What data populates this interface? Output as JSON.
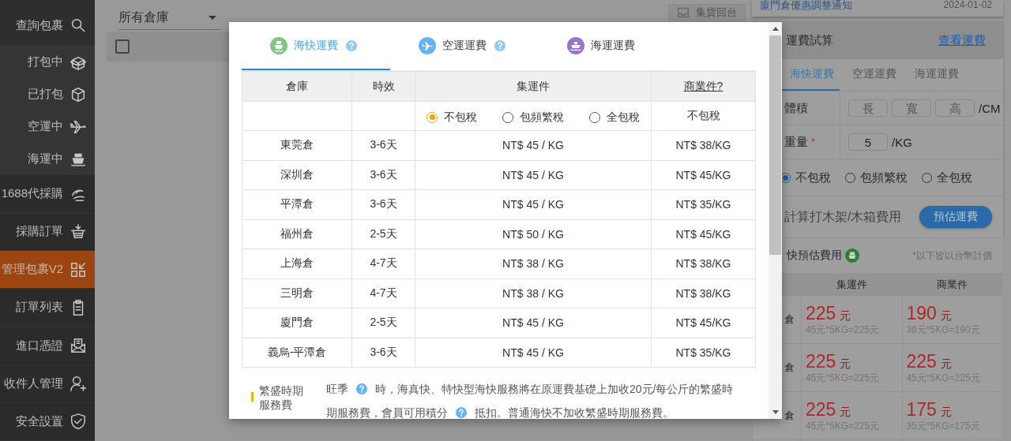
{
  "sidebar": {
    "items": [
      {
        "label": "查詢包裹",
        "selected": false,
        "expanded": true,
        "children": [
          {
            "label": "打包中",
            "selected": false
          },
          {
            "label": "已打包",
            "selected": false
          },
          {
            "label": "空運中",
            "selected": false
          },
          {
            "label": "海運中",
            "selected": false
          }
        ]
      },
      {
        "label": "1688代採購",
        "selected": false
      },
      {
        "label": "採購訂單",
        "selected": false
      },
      {
        "label": "管理包裹V2",
        "selected": true
      },
      {
        "label": "訂單列表",
        "selected": false
      },
      {
        "label": "進口憑證",
        "selected": false
      },
      {
        "label": "收件人管理",
        "selected": false
      },
      {
        "label": "安全設置",
        "selected": false
      }
    ]
  },
  "toolbar": {
    "warehouse_select": {
      "value": "所有倉庫"
    },
    "button": {
      "label": "集貨回台",
      "disabled": true
    }
  },
  "list": {
    "header_checkbox": {
      "checked": false
    }
  },
  "notice": {
    "title": "廈門倉優惠調整通知",
    "date": "2024-01-02"
  },
  "calculator": {
    "title": "運費試算",
    "link": "查看運費",
    "tabs": [
      {
        "label": "海快運費",
        "selected": true
      },
      {
        "label": "空運運費",
        "selected": false
      },
      {
        "label": "海運運費",
        "selected": false
      }
    ],
    "dimensions": {
      "label": "體積",
      "fields": [
        {
          "placeholder": "長"
        },
        {
          "placeholder": "寬"
        },
        {
          "placeholder": "高"
        }
      ],
      "unit": "/CM"
    },
    "weight": {
      "label": "重量",
      "required_mark": "*",
      "value": "5",
      "unit": "/KG"
    },
    "tax_options": [
      {
        "label": "不包稅",
        "selected": true
      },
      {
        "label": "包頻繁稅",
        "selected": false
      },
      {
        "label": "全包稅",
        "selected": false
      }
    ],
    "wood_crate": {
      "label": "計算打木架/木箱費用"
    },
    "submit": "預估運費"
  },
  "estimate": {
    "title": "快預估費用",
    "note": "*以下皆以台幣計價",
    "columns": [
      "集運件",
      "商業件"
    ],
    "rows": [
      {
        "warehouse": "倉",
        "cells": [
          {
            "amount": "225",
            "unit": "元",
            "formula": "45元*5KG=225元"
          },
          {
            "amount": "190",
            "unit": "元",
            "formula": "38元*5KG=190元"
          }
        ]
      },
      {
        "warehouse": "倉",
        "cells": [
          {
            "amount": "225",
            "unit": "元",
            "formula": "45元*5KG=225元"
          },
          {
            "amount": "225",
            "unit": "元",
            "formula": "45元*5KG=225元"
          }
        ]
      },
      {
        "warehouse": "倉",
        "cells": [
          {
            "amount": "225",
            "unit": "元",
            "formula": "45元*5KG=225元"
          },
          {
            "amount": "175",
            "unit": "元",
            "formula": "35元*5KG=175元"
          }
        ]
      }
    ]
  },
  "modal": {
    "tabs": [
      {
        "label": "海快運費",
        "color": "#81c784",
        "help": true,
        "selected": true
      },
      {
        "label": "空運運費",
        "color": "#64b5f6",
        "help": true,
        "selected": false
      },
      {
        "label": "海運運費",
        "color": "#9575cd",
        "help": false,
        "selected": false
      }
    ],
    "table": {
      "columns": [
        "倉庫",
        "時效",
        "集運件",
        "商業件?"
      ],
      "tax_options": [
        {
          "label": "不包稅",
          "selected": true
        },
        {
          "label": "包頻繁稅",
          "selected": false
        },
        {
          "label": "全包稅",
          "selected": false
        }
      ],
      "business_tax": "不包稅",
      "rows": [
        {
          "warehouse": "東莞倉",
          "time": "3-6天",
          "price": "NT$ 45 / KG",
          "business": "NT$ 38/KG"
        },
        {
          "warehouse": "深圳倉",
          "time": "3-6天",
          "price": "NT$ 45 / KG",
          "business": "NT$ 45/KG"
        },
        {
          "warehouse": "平潭倉",
          "time": "3-6天",
          "price": "NT$ 45 / KG",
          "business": "NT$ 35/KG"
        },
        {
          "warehouse": "福州倉",
          "time": "2-5天",
          "price": "NT$ 50 / KG",
          "business": "NT$ 45/KG"
        },
        {
          "warehouse": "上海倉",
          "time": "4-7天",
          "price": "NT$ 38 / KG",
          "business": "NT$ 38/KG"
        },
        {
          "warehouse": "三明倉",
          "time": "4-7天",
          "price": "NT$ 38 / KG",
          "business": "NT$ 38/KG"
        },
        {
          "warehouse": "廈門倉",
          "time": "2-5天",
          "price": "NT$ 45 / KG",
          "business": "NT$ 45/KG"
        },
        {
          "warehouse": "義烏-平潭倉",
          "time": "3-6天",
          "price": "NT$ 45 / KG",
          "business": "NT$ 35/KG"
        }
      ]
    },
    "note": {
      "label": "繁盛時期服務費",
      "segments": [
        {
          "kind": "text",
          "text": "旺季"
        },
        {
          "kind": "help"
        },
        {
          "kind": "text",
          "text": "時，海真快、特快型海快服務將在原運費基礎上加收20元/每公斤的繁盛時"
        },
        {
          "kind": "text",
          "text": "期服務費，會員可用積分"
        },
        {
          "kind": "help"
        },
        {
          "kind": "text",
          "text": "抵扣。普通海快不加收繁盛時期服務費。"
        }
      ]
    }
  }
}
